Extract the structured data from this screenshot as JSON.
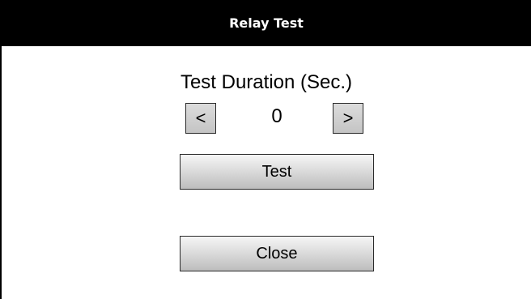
{
  "window": {
    "title": "Relay Test"
  },
  "duration": {
    "label": "Test Duration (Sec.)",
    "value": "0",
    "decrement_label": "<",
    "increment_label": ">"
  },
  "actions": {
    "test_label": "Test",
    "close_label": "Close"
  }
}
